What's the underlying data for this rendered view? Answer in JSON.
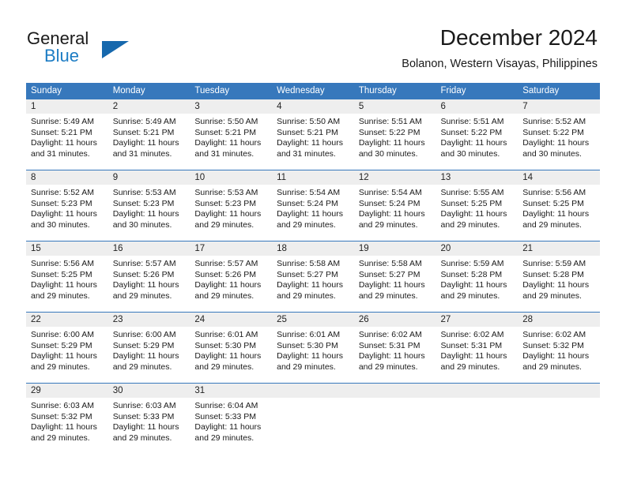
{
  "brand": {
    "name_part1": "General",
    "name_part2": "Blue"
  },
  "header": {
    "title": "December 2024",
    "location": "Bolanon, Western Visayas, Philippines"
  },
  "colors": {
    "header_blue": "#3778bc",
    "logo_blue": "#1c7cc4",
    "daynum_bg": "#eeeeee",
    "text": "#1a1a1a"
  },
  "weekdays": [
    "Sunday",
    "Monday",
    "Tuesday",
    "Wednesday",
    "Thursday",
    "Friday",
    "Saturday"
  ],
  "weeks": [
    {
      "days": [
        {
          "num": "1",
          "sunrise": "Sunrise: 5:49 AM",
          "sunset": "Sunset: 5:21 PM",
          "daylight1": "Daylight: 11 hours",
          "daylight2": "and 31 minutes."
        },
        {
          "num": "2",
          "sunrise": "Sunrise: 5:49 AM",
          "sunset": "Sunset: 5:21 PM",
          "daylight1": "Daylight: 11 hours",
          "daylight2": "and 31 minutes."
        },
        {
          "num": "3",
          "sunrise": "Sunrise: 5:50 AM",
          "sunset": "Sunset: 5:21 PM",
          "daylight1": "Daylight: 11 hours",
          "daylight2": "and 31 minutes."
        },
        {
          "num": "4",
          "sunrise": "Sunrise: 5:50 AM",
          "sunset": "Sunset: 5:21 PM",
          "daylight1": "Daylight: 11 hours",
          "daylight2": "and 31 minutes."
        },
        {
          "num": "5",
          "sunrise": "Sunrise: 5:51 AM",
          "sunset": "Sunset: 5:22 PM",
          "daylight1": "Daylight: 11 hours",
          "daylight2": "and 30 minutes."
        },
        {
          "num": "6",
          "sunrise": "Sunrise: 5:51 AM",
          "sunset": "Sunset: 5:22 PM",
          "daylight1": "Daylight: 11 hours",
          "daylight2": "and 30 minutes."
        },
        {
          "num": "7",
          "sunrise": "Sunrise: 5:52 AM",
          "sunset": "Sunset: 5:22 PM",
          "daylight1": "Daylight: 11 hours",
          "daylight2": "and 30 minutes."
        }
      ]
    },
    {
      "days": [
        {
          "num": "8",
          "sunrise": "Sunrise: 5:52 AM",
          "sunset": "Sunset: 5:23 PM",
          "daylight1": "Daylight: 11 hours",
          "daylight2": "and 30 minutes."
        },
        {
          "num": "9",
          "sunrise": "Sunrise: 5:53 AM",
          "sunset": "Sunset: 5:23 PM",
          "daylight1": "Daylight: 11 hours",
          "daylight2": "and 30 minutes."
        },
        {
          "num": "10",
          "sunrise": "Sunrise: 5:53 AM",
          "sunset": "Sunset: 5:23 PM",
          "daylight1": "Daylight: 11 hours",
          "daylight2": "and 29 minutes."
        },
        {
          "num": "11",
          "sunrise": "Sunrise: 5:54 AM",
          "sunset": "Sunset: 5:24 PM",
          "daylight1": "Daylight: 11 hours",
          "daylight2": "and 29 minutes."
        },
        {
          "num": "12",
          "sunrise": "Sunrise: 5:54 AM",
          "sunset": "Sunset: 5:24 PM",
          "daylight1": "Daylight: 11 hours",
          "daylight2": "and 29 minutes."
        },
        {
          "num": "13",
          "sunrise": "Sunrise: 5:55 AM",
          "sunset": "Sunset: 5:25 PM",
          "daylight1": "Daylight: 11 hours",
          "daylight2": "and 29 minutes."
        },
        {
          "num": "14",
          "sunrise": "Sunrise: 5:56 AM",
          "sunset": "Sunset: 5:25 PM",
          "daylight1": "Daylight: 11 hours",
          "daylight2": "and 29 minutes."
        }
      ]
    },
    {
      "days": [
        {
          "num": "15",
          "sunrise": "Sunrise: 5:56 AM",
          "sunset": "Sunset: 5:25 PM",
          "daylight1": "Daylight: 11 hours",
          "daylight2": "and 29 minutes."
        },
        {
          "num": "16",
          "sunrise": "Sunrise: 5:57 AM",
          "sunset": "Sunset: 5:26 PM",
          "daylight1": "Daylight: 11 hours",
          "daylight2": "and 29 minutes."
        },
        {
          "num": "17",
          "sunrise": "Sunrise: 5:57 AM",
          "sunset": "Sunset: 5:26 PM",
          "daylight1": "Daylight: 11 hours",
          "daylight2": "and 29 minutes."
        },
        {
          "num": "18",
          "sunrise": "Sunrise: 5:58 AM",
          "sunset": "Sunset: 5:27 PM",
          "daylight1": "Daylight: 11 hours",
          "daylight2": "and 29 minutes."
        },
        {
          "num": "19",
          "sunrise": "Sunrise: 5:58 AM",
          "sunset": "Sunset: 5:27 PM",
          "daylight1": "Daylight: 11 hours",
          "daylight2": "and 29 minutes."
        },
        {
          "num": "20",
          "sunrise": "Sunrise: 5:59 AM",
          "sunset": "Sunset: 5:28 PM",
          "daylight1": "Daylight: 11 hours",
          "daylight2": "and 29 minutes."
        },
        {
          "num": "21",
          "sunrise": "Sunrise: 5:59 AM",
          "sunset": "Sunset: 5:28 PM",
          "daylight1": "Daylight: 11 hours",
          "daylight2": "and 29 minutes."
        }
      ]
    },
    {
      "days": [
        {
          "num": "22",
          "sunrise": "Sunrise: 6:00 AM",
          "sunset": "Sunset: 5:29 PM",
          "daylight1": "Daylight: 11 hours",
          "daylight2": "and 29 minutes."
        },
        {
          "num": "23",
          "sunrise": "Sunrise: 6:00 AM",
          "sunset": "Sunset: 5:29 PM",
          "daylight1": "Daylight: 11 hours",
          "daylight2": "and 29 minutes."
        },
        {
          "num": "24",
          "sunrise": "Sunrise: 6:01 AM",
          "sunset": "Sunset: 5:30 PM",
          "daylight1": "Daylight: 11 hours",
          "daylight2": "and 29 minutes."
        },
        {
          "num": "25",
          "sunrise": "Sunrise: 6:01 AM",
          "sunset": "Sunset: 5:30 PM",
          "daylight1": "Daylight: 11 hours",
          "daylight2": "and 29 minutes."
        },
        {
          "num": "26",
          "sunrise": "Sunrise: 6:02 AM",
          "sunset": "Sunset: 5:31 PM",
          "daylight1": "Daylight: 11 hours",
          "daylight2": "and 29 minutes."
        },
        {
          "num": "27",
          "sunrise": "Sunrise: 6:02 AM",
          "sunset": "Sunset: 5:31 PM",
          "daylight1": "Daylight: 11 hours",
          "daylight2": "and 29 minutes."
        },
        {
          "num": "28",
          "sunrise": "Sunrise: 6:02 AM",
          "sunset": "Sunset: 5:32 PM",
          "daylight1": "Daylight: 11 hours",
          "daylight2": "and 29 minutes."
        }
      ]
    },
    {
      "days": [
        {
          "num": "29",
          "sunrise": "Sunrise: 6:03 AM",
          "sunset": "Sunset: 5:32 PM",
          "daylight1": "Daylight: 11 hours",
          "daylight2": "and 29 minutes."
        },
        {
          "num": "30",
          "sunrise": "Sunrise: 6:03 AM",
          "sunset": "Sunset: 5:33 PM",
          "daylight1": "Daylight: 11 hours",
          "daylight2": "and 29 minutes."
        },
        {
          "num": "31",
          "sunrise": "Sunrise: 6:04 AM",
          "sunset": "Sunset: 5:33 PM",
          "daylight1": "Daylight: 11 hours",
          "daylight2": "and 29 minutes."
        },
        {
          "num": "",
          "sunrise": "",
          "sunset": "",
          "daylight1": "",
          "daylight2": ""
        },
        {
          "num": "",
          "sunrise": "",
          "sunset": "",
          "daylight1": "",
          "daylight2": ""
        },
        {
          "num": "",
          "sunrise": "",
          "sunset": "",
          "daylight1": "",
          "daylight2": ""
        },
        {
          "num": "",
          "sunrise": "",
          "sunset": "",
          "daylight1": "",
          "daylight2": ""
        }
      ]
    }
  ]
}
